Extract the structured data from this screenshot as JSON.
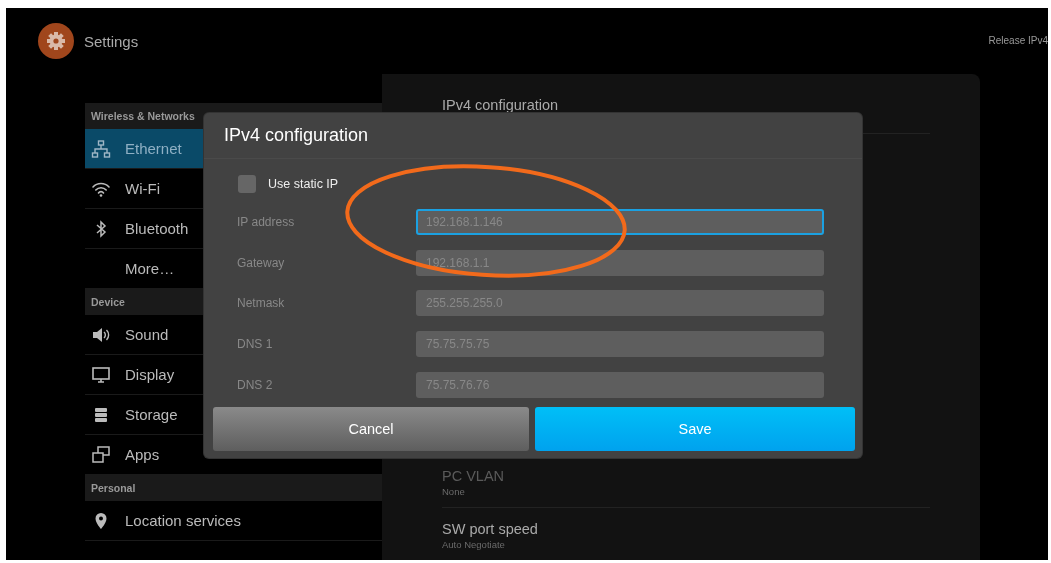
{
  "header": {
    "title": "Settings",
    "action": "Release IPv4"
  },
  "sidebar": {
    "sections": [
      {
        "header": "Wireless & Networks",
        "items": [
          {
            "label": "Ethernet",
            "selected": true
          },
          {
            "label": "Wi-Fi",
            "selected": false
          },
          {
            "label": "Bluetooth",
            "selected": false
          },
          {
            "label": "More…",
            "selected": false
          }
        ]
      },
      {
        "header": "Device",
        "items": [
          {
            "label": "Sound",
            "selected": false
          },
          {
            "label": "Display",
            "selected": false
          },
          {
            "label": "Storage",
            "selected": false
          },
          {
            "label": "Apps",
            "selected": false
          }
        ]
      },
      {
        "header": "Personal",
        "items": [
          {
            "label": "Location services",
            "selected": false
          }
        ]
      }
    ]
  },
  "panel": {
    "top_rows": [
      {
        "title": "IPv4 configuration",
        "disabled": false
      }
    ],
    "bottom_rows": [
      {
        "title": "PC VLAN",
        "summary": "None",
        "disabled": true
      },
      {
        "title": "SW port speed",
        "summary": "Auto Negotiate",
        "disabled": false
      }
    ]
  },
  "dialog": {
    "title": "IPv4 configuration",
    "checkbox": {
      "label": "Use static IP",
      "checked": false
    },
    "fields": [
      {
        "label": "IP address",
        "value": "192.168.1.146",
        "disabled": true,
        "focused": true
      },
      {
        "label": "Gateway",
        "value": "192.168.1.1",
        "disabled": true,
        "focused": false
      },
      {
        "label": "Netmask",
        "value": "255.255.255.0",
        "disabled": true,
        "focused": false
      },
      {
        "label": "DNS 1",
        "value": "75.75.75.75",
        "disabled": true,
        "focused": false
      },
      {
        "label": "DNS 2",
        "value": "75.75.76.76",
        "disabled": true,
        "focused": false
      }
    ],
    "buttons": [
      {
        "label": "Cancel",
        "kind": "secondary"
      },
      {
        "label": "Save",
        "kind": "primary"
      }
    ]
  }
}
